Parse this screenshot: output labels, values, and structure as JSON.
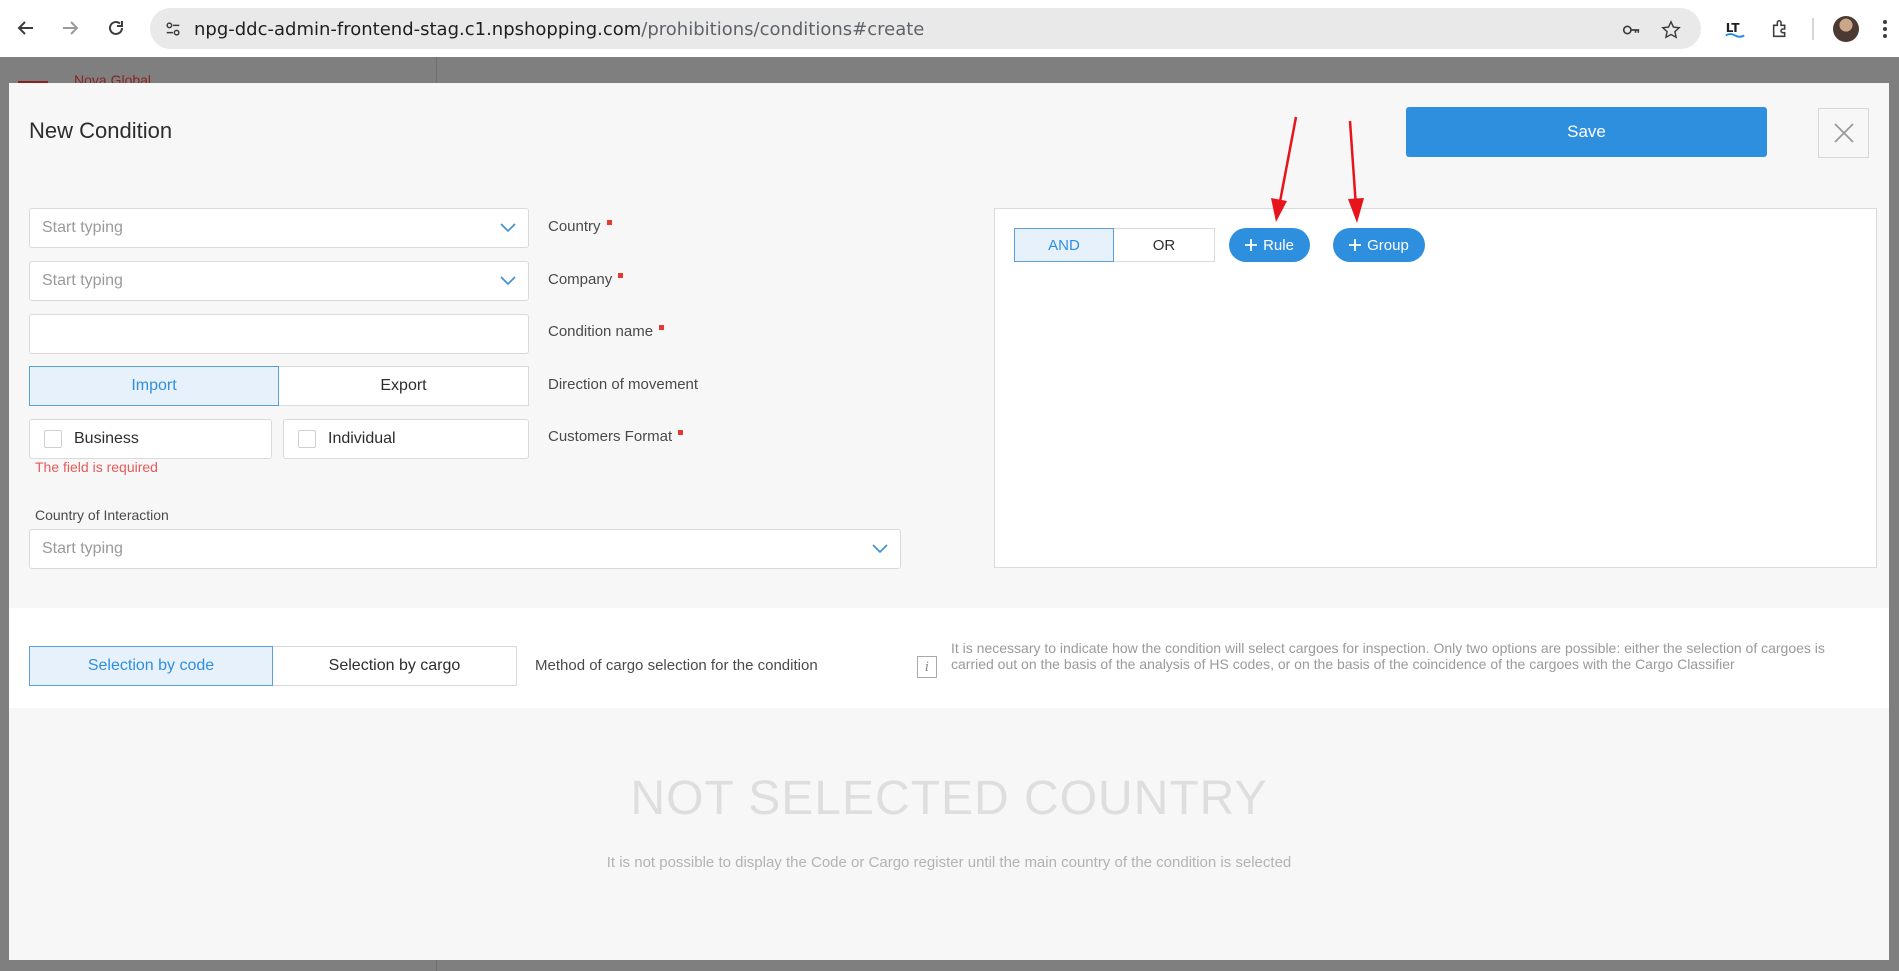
{
  "browser": {
    "url_host": "npg-ddc-admin-frontend-stag.c1.npshopping.com",
    "url_path": "/prohibitions/conditions#create"
  },
  "background_page": {
    "brand": "Nova Global"
  },
  "modal": {
    "title": "New Condition",
    "save_label": "Save",
    "country": {
      "placeholder": "Start typing",
      "label": "Country"
    },
    "company": {
      "placeholder": "Start typing",
      "label": "Company"
    },
    "condition_name": {
      "value": "",
      "label": "Condition name"
    },
    "direction": {
      "label": "Direction of movement",
      "options": [
        "Import",
        "Export"
      ],
      "selected": "Import"
    },
    "customers_format": {
      "label": "Customers Format",
      "options": [
        "Business",
        "Individual"
      ],
      "error": "The field is required"
    },
    "country_of_interaction": {
      "label": "Country of Interaction",
      "placeholder": "Start typing"
    },
    "rules": {
      "logic_options": [
        "AND",
        "OR"
      ],
      "selected_logic": "AND",
      "add_rule_label": "Rule",
      "add_group_label": "Group"
    },
    "cargo_selection": {
      "options": [
        "Selection by code",
        "Selection by cargo"
      ],
      "selected": "Selection by code",
      "label": "Method of cargo selection for the condition",
      "info": "It is necessary to indicate how the condition will select cargoes for inspection. Only two options are possible: either the selection of cargoes is carried out on the basis of the analysis of HS codes, or on the basis of the coincidence of the cargoes with the Cargo Classifier"
    },
    "empty_state": {
      "title": "NOT SELECTED COUNTRY",
      "subtitle": "It is not possible to display the Code or Cargo register until the main country of the condition is selected"
    }
  },
  "colors": {
    "accent": "#2f8fdf",
    "error": "#e53935",
    "annotation_arrow": "#e8141b"
  }
}
